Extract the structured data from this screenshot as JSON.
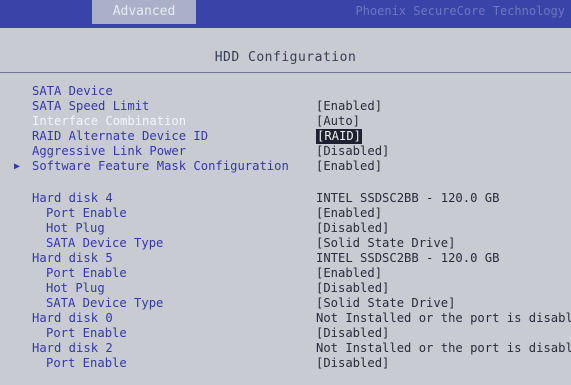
{
  "header": {
    "tab": "Advanced",
    "vendor": "Phoenix SecureCore Technology"
  },
  "title": "HDD Configuration",
  "settings": [
    {
      "label": "SATA Device",
      "value": ""
    },
    {
      "label": "SATA Speed Limit",
      "value": "[Enabled]"
    },
    {
      "label": "Interface Combination",
      "value": "[Auto]"
    },
    {
      "label": "RAID Alternate Device ID",
      "value": "[RAID]"
    },
    {
      "label": "Aggressive Link Power",
      "value": "[Disabled]"
    },
    {
      "label": "Software Feature Mask Configuration",
      "value": "[Enabled]"
    }
  ],
  "disks": [
    {
      "label": "Hard disk 4",
      "value": "INTEL SSDSC2BB - 120.0 GB"
    },
    {
      "label": "Port Enable",
      "value": "[Enabled]"
    },
    {
      "label": "Hot Plug",
      "value": "[Disabled]"
    },
    {
      "label": "SATA Device Type",
      "value": "[Solid State Drive]"
    },
    {
      "label": "Hard disk 5",
      "value": "INTEL SSDSC2BB - 120.0 GB"
    },
    {
      "label": "Port Enable",
      "value": "[Enabled]"
    },
    {
      "label": "Hot Plug",
      "value": "[Disabled]"
    },
    {
      "label": "SATA Device Type",
      "value": "[Solid State Drive]"
    },
    {
      "label": "Hard disk 0",
      "value": "Not Installed or the port is disabled"
    },
    {
      "label": "Port Enable",
      "value": "[Disabled]"
    },
    {
      "label": "Hard disk 2",
      "value": "Not Installed or the port is disabled"
    },
    {
      "label": "Port Enable",
      "value": "[Disabled]"
    }
  ]
}
